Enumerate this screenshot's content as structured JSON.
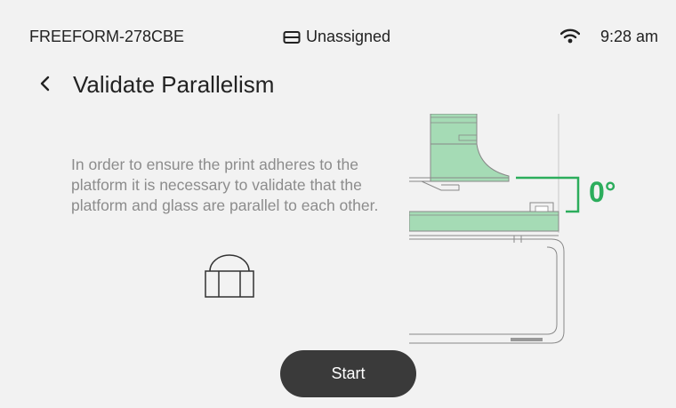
{
  "status": {
    "device_name": "FREEFORM-278CBE",
    "assignment": "Unassigned",
    "time": "9:28 am"
  },
  "header": {
    "title": "Validate Parallelism"
  },
  "main": {
    "description": "In order to ensure the print adheres to the platform it is necessary to validate that the platform and glass are parallel to each other.",
    "angle_label": "0°",
    "start_label": "Start"
  },
  "colors": {
    "accent_green": "#2cad5c",
    "light_green": "#a5dbb5",
    "button_dark": "#3a3a3a",
    "background": "#f2f2f2"
  },
  "icons": {
    "assignment": "printer-tray-icon",
    "wifi": "wifi-icon",
    "back": "chevron-left-icon",
    "part": "print-part-icon"
  }
}
